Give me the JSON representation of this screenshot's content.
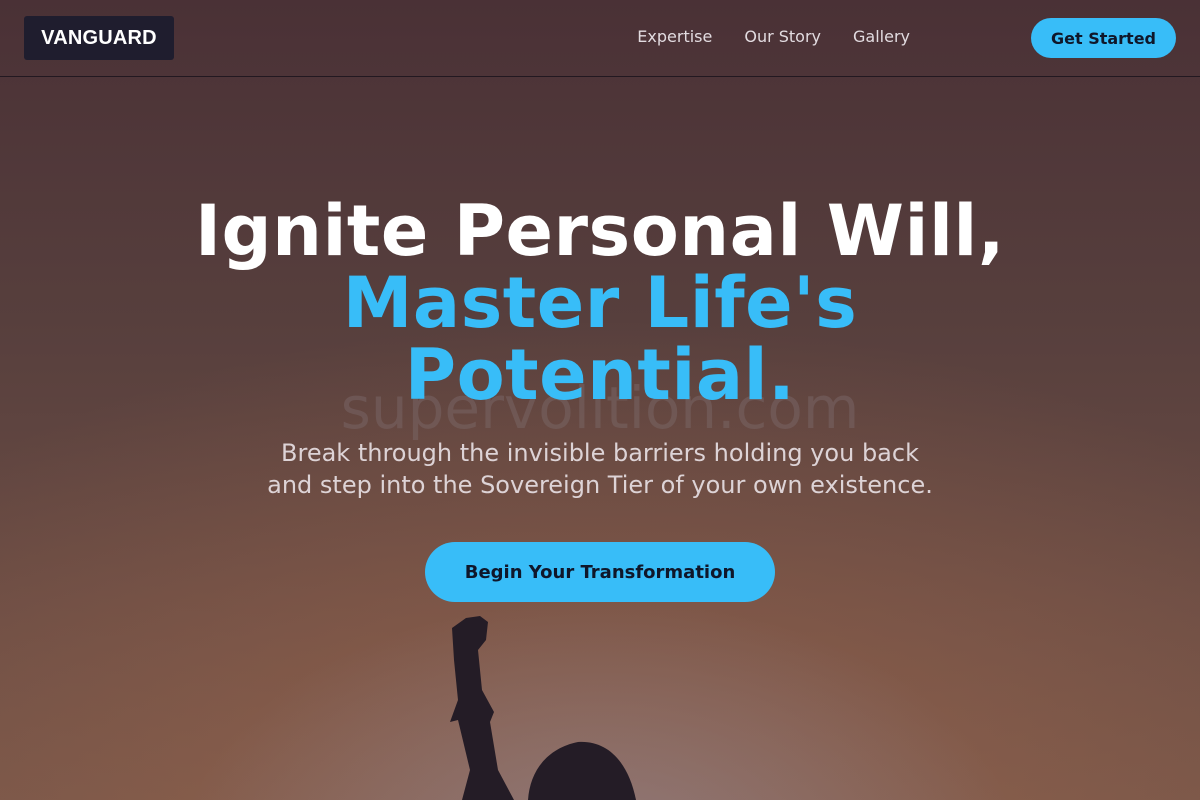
{
  "brand": {
    "logo": "VANGUARD"
  },
  "nav": {
    "links": [
      "Expertise",
      "Our Story",
      "Gallery"
    ],
    "cta": "Get Started"
  },
  "hero": {
    "headline_line1": "Ignite Personal Will,",
    "headline_accent_line1": "Master Life's",
    "headline_accent_line2": "Potential.",
    "watermark": "supervolition.com",
    "subtitle": "Break through the invisible barriers holding you back and step into the Sovereign Tier of your own existence.",
    "cta": "Begin Your Transformation"
  },
  "colors": {
    "accent": "#38bdf8",
    "logo_bg": "#1f1d2e",
    "headline": "#ffffff"
  }
}
